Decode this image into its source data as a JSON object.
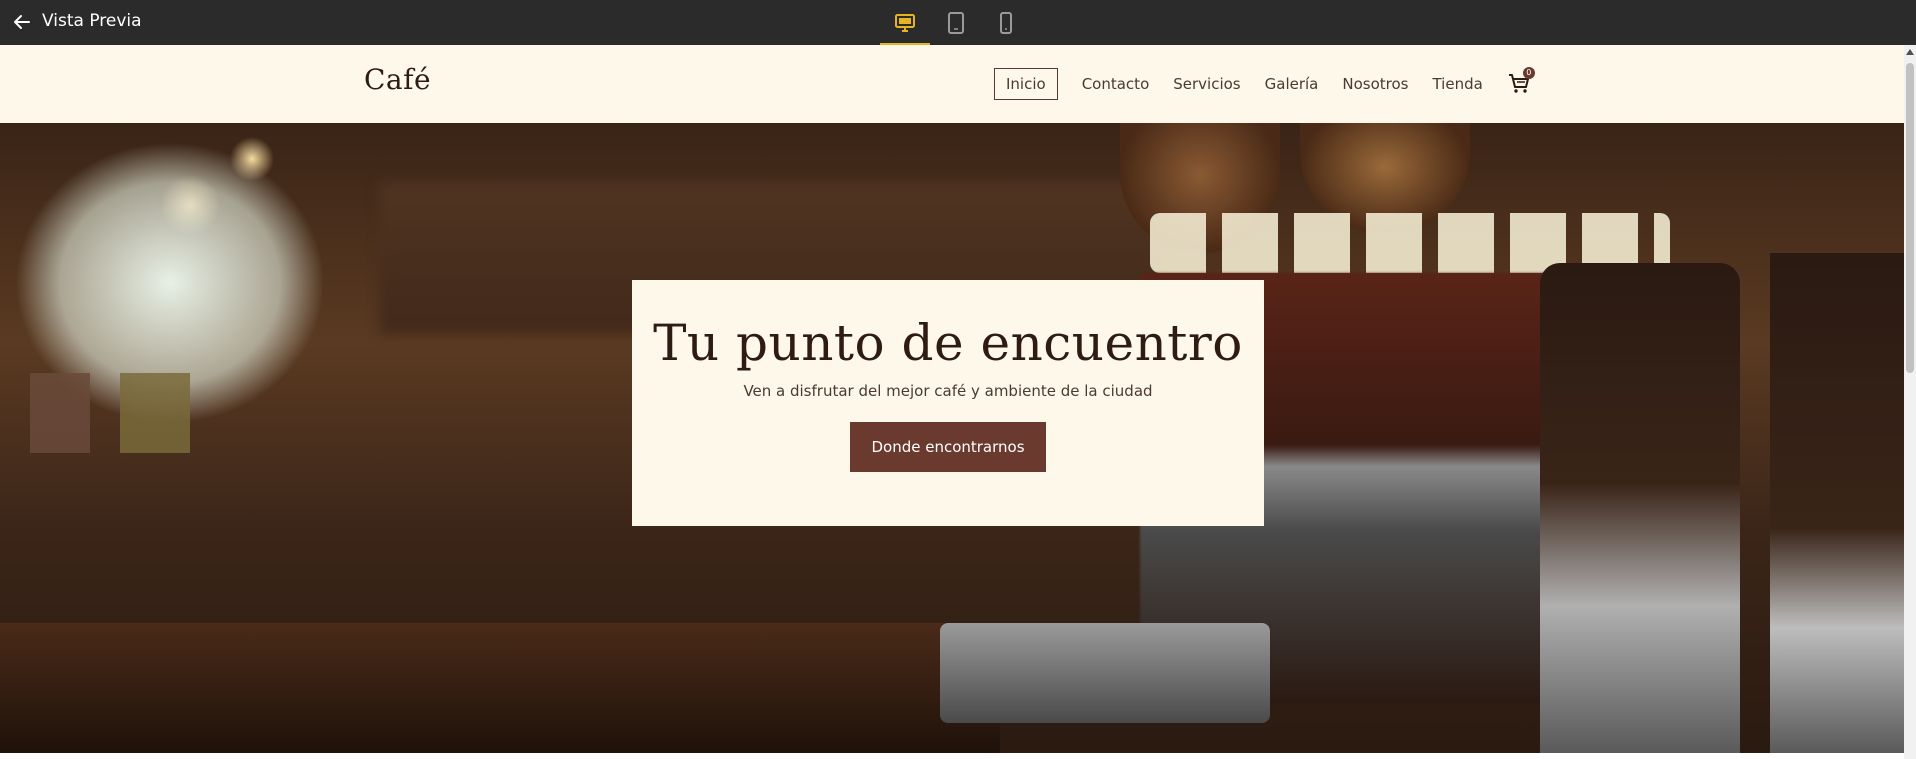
{
  "topbar": {
    "title": "Vista Previa",
    "back_icon": "arrow-left-icon",
    "devices": [
      {
        "name": "desktop",
        "icon": "monitor-icon",
        "active": true
      },
      {
        "name": "tablet",
        "icon": "tablet-icon",
        "active": false
      },
      {
        "name": "mobile",
        "icon": "phone-icon",
        "active": false
      }
    ],
    "accent_color": "#e6b422",
    "background": "#2b2b2b"
  },
  "site": {
    "logo": "Café",
    "nav": [
      "Inicio",
      "Contacto",
      "Servicios",
      "Galería",
      "Nosotros",
      "Tienda"
    ],
    "cart_count": "0",
    "cart_icon": "cart-icon",
    "header_background": "#fdf8ea",
    "brand_color": "#6b3a2e"
  },
  "hero": {
    "title": "Tu punto de encuentro",
    "subtitle": "Ven a disfrutar del mejor café y ambiente de la ciudad",
    "button_label": "Donde encontrarnos"
  }
}
